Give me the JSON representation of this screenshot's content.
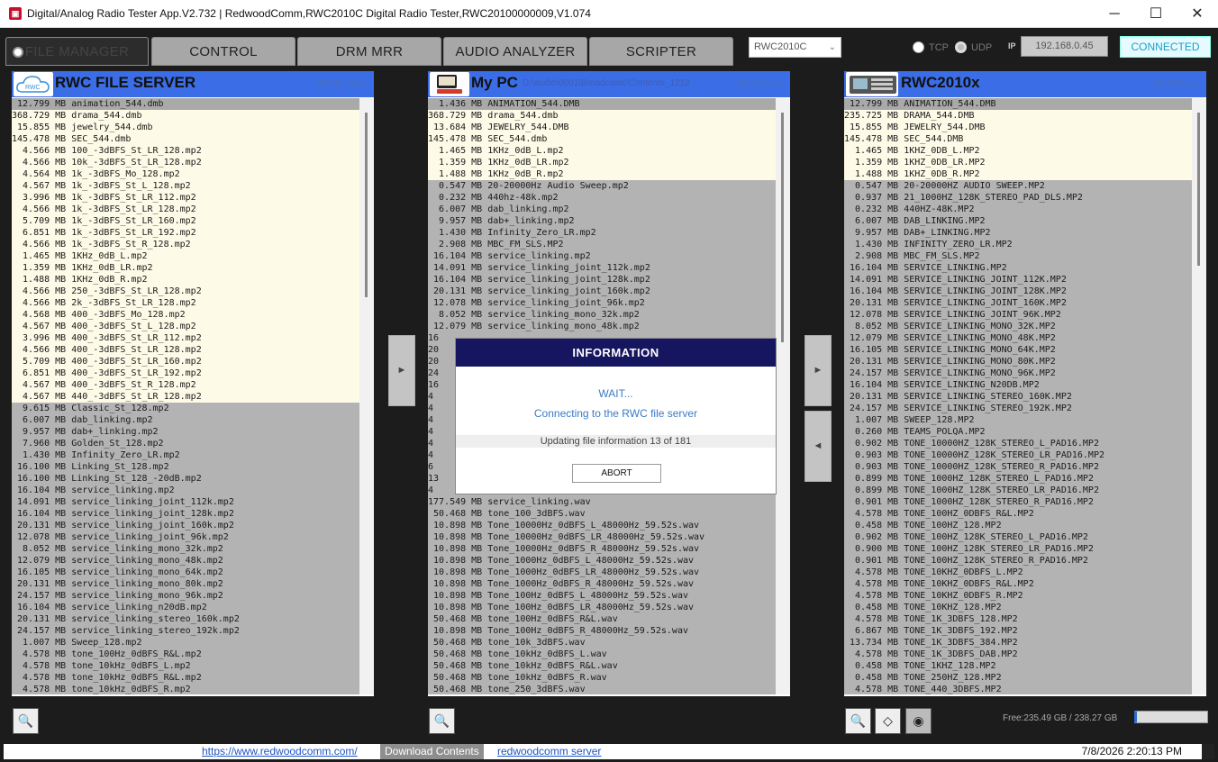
{
  "window": {
    "title": "Digital/Analog Radio Tester App.V2.732 | RedwoodComm,RWC2010C Digital Radio Tester,RWC20100000009,V1.074",
    "app_icon": "radio-tester-icon",
    "minimize": "─",
    "maximize": "☐",
    "close": "✕"
  },
  "tabs": [
    {
      "label": "FILE MANAGER"
    },
    {
      "label": "CONTROL"
    },
    {
      "label": "DRM MRR"
    },
    {
      "label": "AUDIO ANALYZER"
    },
    {
      "label": "SCRIPTER"
    }
  ],
  "device": {
    "selected": "RWC2010C",
    "chevron": "⌄"
  },
  "conn": {
    "tcp": "TCP",
    "udp": "UDP",
    "ip_label": "IP",
    "ip": "192.168.0.45",
    "status": "CONNECTED"
  },
  "left": {
    "title": "RWC FILE SERVER",
    "count": "26/181 files",
    "logo": "RWC",
    "rows": [
      "12.799 MB animation_544.dmb",
      "368.729 MB drama_544.dmb",
      "15.855 MB jewelry_544.dmb",
      "145.478 MB SEC_544.dmb",
      "4.566 MB 100_-3dBFS_St_LR_128.mp2",
      "4.566 MB 10k_-3dBFS_St_LR_128.mp2",
      "4.564 MB 1k_-3dBFS_Mo_128.mp2",
      "4.567 MB 1k_-3dBFS_St_L_128.mp2",
      "3.996 MB 1k_-3dBFS_St_LR_112.mp2",
      "4.566 MB 1k_-3dBFS_St_LR_128.mp2",
      "5.709 MB 1k_-3dBFS_St_LR_160.mp2",
      "6.851 MB 1k_-3dBFS_St_LR_192.mp2",
      "4.566 MB 1k_-3dBFS_St_R_128.mp2",
      "1.465 MB 1KHz_0dB_L.mp2",
      "1.359 MB 1KHz_0dB_LR.mp2",
      "1.488 MB 1KHz_0dB_R.mp2",
      "4.566 MB 250_-3dBFS_St_LR_128.mp2",
      "4.566 MB 2k_-3dBFS_St_LR_128.mp2",
      "4.568 MB 400_-3dBFS_Mo_128.mp2",
      "4.567 MB 400_-3dBFS_St_L_128.mp2",
      "3.996 MB 400_-3dBFS_St_LR_112.mp2",
      "4.566 MB 400_-3dBFS_St_LR_128.mp2",
      "5.709 MB 400_-3dBFS_St_LR_160.mp2",
      "6.851 MB 400_-3dBFS_St_LR_192.mp2",
      "4.567 MB 400_-3dBFS_St_R_128.mp2",
      "4.567 MB 440_-3dBFS_St_LR_128.mp2",
      "9.615 MB Classic_St_128.mp2",
      "6.007 MB dab_linking.mp2",
      "9.957 MB dab+_linking.mp2",
      "7.960 MB Golden_St_128.mp2",
      "1.430 MB Infinity_Zero_LR.mp2",
      "16.100 MB Linking_St_128.mp2",
      "16.100 MB Linking_St_128_-20dB.mp2",
      "16.104 MB service_linking.mp2",
      "14.091 MB service_linking_joint_112k.mp2",
      "16.104 MB service_linking_joint_128k.mp2",
      "20.131 MB service_linking_joint_160k.mp2",
      "12.078 MB service_linking_joint_96k.mp2",
      "8.052 MB service_linking_mono_32k.mp2",
      "12.079 MB service_linking_mono_48k.mp2",
      "16.105 MB service_linking_mono_64k.mp2",
      "20.131 MB service_linking_mono_80k.mp2",
      "24.157 MB service_linking_mono_96k.mp2",
      "16.104 MB service_linking_n20dB.mp2",
      "20.131 MB service_linking_stereo_160k.mp2",
      "24.157 MB service_linking_stereo_192k.mp2",
      "1.007 MB Sweep_128.mp2",
      "4.578 MB tone_100Hz_0dBFS_R&L.mp2",
      "4.578 MB tone_10kHz_0dBFS_L.mp2",
      "4.578 MB tone_10kHz_0dBFS_R&L.mp2",
      "4.578 MB tone_10kHz_0dBFS_R.mp2"
    ]
  },
  "mid": {
    "title": "My PC",
    "path": "D:\\audio\\0001\\Broadcasts\\Contents_1212",
    "count": "6/140 files",
    "rows": [
      "1.436 MB ANIMATION_544.DMB",
      "368.729 MB drama_544.dmb",
      "13.684 MB JEWELRY_544.DMB",
      "145.478 MB SEC_544.dmb",
      "1.465 MB 1KHz_0dB_L.mp2",
      "1.359 MB 1KHz_0dB_LR.mp2",
      "1.488 MB 1KHz_0dB_R.mp2",
      "0.547 MB 20-20000Hz Audio Sweep.mp2",
      "0.232 MB 440hz-48k.mp2",
      "6.007 MB dab_linking.mp2",
      "9.957 MB dab+_linking.mp2",
      "1.430 MB Infinity_Zero_LR.mp2",
      "2.908 MB MBC_FM_SLS.MP2",
      "16.104 MB service_linking.mp2",
      "14.091 MB service_linking_joint_112k.mp2",
      "16.104 MB service_linking_joint_128k.mp2",
      "20.131 MB service_linking_joint_160k.mp2",
      "12.078 MB service_linking_joint_96k.mp2",
      "8.052 MB service_linking_mono_32k.mp2",
      "12.079 MB service_linking_mono_48k.mp2",
      "16",
      "20",
      "20",
      "24",
      "16",
      "4",
      "4",
      "4",
      "4",
      "4",
      "4",
      "6",
      "13",
      "4",
      "177.549 MB service_linking.wav",
      "50.468 MB tone_100_3dBFS.wav",
      "10.898 MB Tone_10000Hz_0dBFS_L_48000Hz_59.52s.wav",
      "10.898 MB Tone_10000Hz_0dBFS_LR_48000Hz_59.52s.wav",
      "10.898 MB Tone_10000Hz_0dBFS_R_48000Hz_59.52s.wav",
      "10.898 MB Tone_1000Hz_0dBFS_L_48000Hz_59.52s.wav",
      "10.898 MB Tone_1000Hz_0dBFS_LR_48000Hz_59.52s.wav",
      "10.898 MB Tone_1000Hz_0dBFS_R_48000Hz_59.52s.wav",
      "10.898 MB Tone_100Hz_0dBFS_L_48000Hz_59.52s.wav",
      "10.898 MB Tone_100Hz_0dBFS_LR_48000Hz_59.52s.wav",
      "50.468 MB tone_100Hz_0dBFS_R&L.wav",
      "10.898 MB Tone_100Hz_0dBFS_R_48000Hz_59.52s.wav",
      "50.468 MB tone_10k_3dBFS.wav",
      "50.468 MB tone_10kHz_0dBFS_L.wav",
      "50.468 MB tone_10kHz_0dBFS_R&L.wav",
      "50.468 MB tone_10kHz_0dBFS_R.wav",
      "50.468 MB tone_250_3dBFS.wav"
    ]
  },
  "right": {
    "title": "RWC2010x",
    "count": "6/188 files",
    "rows": [
      "12.799 MB ANIMATION_544.DMB",
      "235.725 MB DRAMA_544.DMB",
      "15.855 MB JEWELRY_544.DMB",
      "145.478 MB SEC_544.DMB",
      "1.465 MB 1KHZ_0DB_L.MP2",
      "1.359 MB 1KHZ_0DB_LR.MP2",
      "1.488 MB 1KHZ_0DB_R.MP2",
      "0.547 MB 20-20000HZ AUDIO SWEEP.MP2",
      "0.937 MB 21_1000HZ_128K_STEREO_PAD_DLS.MP2",
      "0.232 MB 440HZ-48K.MP2",
      "6.007 MB DAB_LINKING.MP2",
      "9.957 MB DAB+_LINKING.MP2",
      "1.430 MB INFINITY_ZERO_LR.MP2",
      "2.908 MB MBC_FM_SLS.MP2",
      "16.104 MB SERVICE_LINKING.MP2",
      "14.091 MB SERVICE_LINKING_JOINT_112K.MP2",
      "16.104 MB SERVICE_LINKING_JOINT_128K.MP2",
      "20.131 MB SERVICE_LINKING_JOINT_160K.MP2",
      "12.078 MB SERVICE_LINKING_JOINT_96K.MP2",
      "8.052 MB SERVICE_LINKING_MONO_32K.MP2",
      "12.079 MB SERVICE_LINKING_MONO_48K.MP2",
      "16.105 MB SERVICE_LINKING_MONO_64K.MP2",
      "20.131 MB SERVICE_LINKING_MONO_80K.MP2",
      "24.157 MB SERVICE_LINKING_MONO_96K.MP2",
      "16.104 MB SERVICE_LINKING_N20DB.MP2",
      "20.131 MB SERVICE_LINKING_STEREO_160K.MP2",
      "24.157 MB SERVICE_LINKING_STEREO_192K.MP2",
      "1.007 MB SWEEP_128.MP2",
      "0.260 MB TEAMS_POLQA.MP2",
      "0.902 MB TONE_10000HZ_128K_STEREO_L_PAD16.MP2",
      "0.903 MB TONE_10000HZ_128K_STEREO_LR_PAD16.MP2",
      "0.903 MB TONE_10000HZ_128K_STEREO_R_PAD16.MP2",
      "0.899 MB TONE_1000HZ_128K_STEREO_L_PAD16.MP2",
      "0.899 MB TONE_1000HZ_128K_STEREO_LR_PAD16.MP2",
      "0.901 MB TONE_1000HZ_128K_STEREO_R_PAD16.MP2",
      "4.578 MB TONE_100HZ_0DBFS_R&L.MP2",
      "0.458 MB TONE_100HZ_128.MP2",
      "0.902 MB TONE_100HZ_128K_STEREO_L_PAD16.MP2",
      "0.900 MB TONE_100HZ_128K_STEREO_LR_PAD16.MP2",
      "0.901 MB TONE_100HZ_128K_STEREO_R_PAD16.MP2",
      "4.578 MB TONE_10KHZ_0DBFS_L.MP2",
      "4.578 MB TONE_10KHZ_0DBFS_R&L.MP2",
      "4.578 MB TONE_10KHZ_0DBFS_R.MP2",
      "0.458 MB TONE_10KHZ_128.MP2",
      "4.578 MB TONE_1K_3DBFS_128.MP2",
      "6.867 MB TONE_1K_3DBFS_192.MP2",
      "13.734 MB TONE_1K_3DBFS_384.MP2",
      "4.578 MB TONE_1K_3DBFS_DAB.MP2",
      "0.458 MB TONE_1KHZ_128.MP2",
      "0.458 MB TONE_250HZ_128.MP2",
      "4.578 MB TONE_440_3DBFS.MP2"
    ]
  },
  "modal": {
    "title": "INFORMATION",
    "wait": "WAIT...",
    "message": "Connecting to the RWC file server",
    "progress": "Updating file information 13 of 181",
    "abort": "ABORT"
  },
  "arrows": {
    "right": "►",
    "left": "◄"
  },
  "footer": {
    "free": "Free:235.49 GB / 238.27 GB",
    "progress_fraction": 0.0
  },
  "status": {
    "link1": "https://www.redwoodcomm.com/",
    "download": "Download Contents",
    "link2": "redwoodcomm server",
    "datetime": "7/8/2026 2:20:13 PM"
  }
}
